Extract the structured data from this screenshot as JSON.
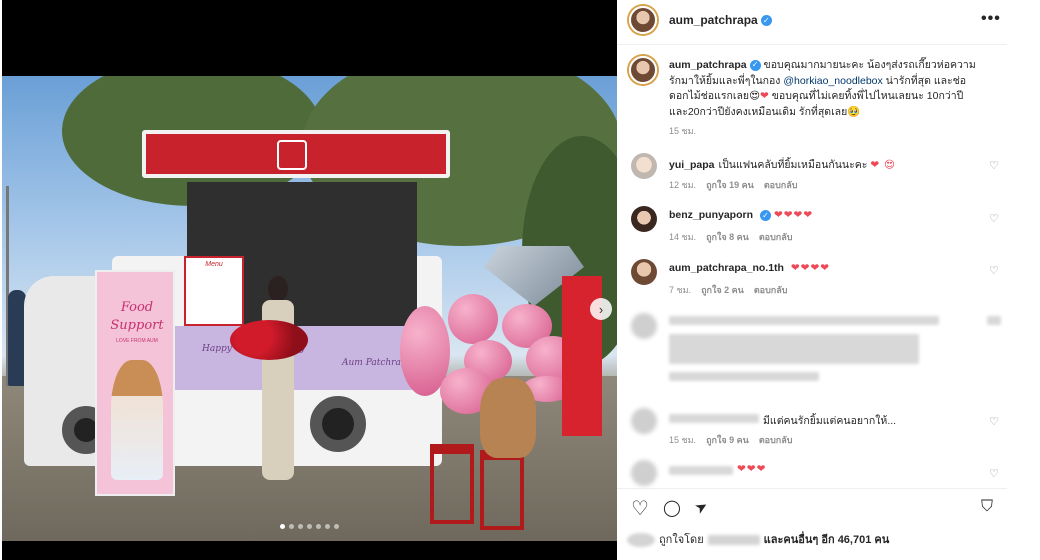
{
  "post": {
    "username": "aum_patchrapa",
    "more_label": "•••",
    "next_label": "›",
    "carousel": {
      "count": 7,
      "active_index": 0
    }
  },
  "photo_text": {
    "banner_title_1": "Food",
    "banner_title_2": "Support",
    "banner_sub": "LOVE FROM AUM",
    "counter_left": "Happy Valentine's Day",
    "counter_right": "Aum Patchrapa",
    "menu_board": "Menu"
  },
  "caption": {
    "username": "aum_patchrapa",
    "text_1": "ขอบคุณมากมายนะคะ น้องๆส่งรถเกี๊ยวห่อความรักมาให้ยิ้มและพี่ๆในกอง",
    "mention": "@horkiao_noodlebox",
    "text_2": "น่ารักที่สุด และช่อดอกไม้ช่อแรกเลย",
    "text_3": "ขอบคุณที่ไม่เคยทิ้งพี่ไปไหนเลยนะ 10กว่าปีและ20กว่าปียังคงเหมือนเดิม รักที่สุดเลย",
    "emoji_1": "😍",
    "emoji_heart": "❤",
    "emoji_2": "🥹",
    "time": "15 ชม."
  },
  "comments": [
    {
      "username": "yui_papa",
      "text": "เป็นแฟนคลับที่ยิ้มเหมือนกันนะคะ",
      "emoji": "❤ 😍",
      "time": "12 ชม.",
      "likes": "ถูกใจ 19 คน",
      "reply": "ตอบกลับ"
    },
    {
      "username": "benz_punyaporn",
      "text": "",
      "emoji": "❤❤❤❤",
      "time": "14 ชม.",
      "likes": "ถูกใจ 8 คน",
      "reply": "ตอบกลับ"
    },
    {
      "username": "aum_patchrapa_no.1th",
      "text": "",
      "emoji": "❤❤❤❤",
      "time": "7 ชม.",
      "likes": "ถูกใจ 2 คน",
      "reply": "ตอบกลับ"
    },
    {
      "username": "",
      "text": "มีแต่คนรักยิ้มแต่คนอยากให้...",
      "emoji": "",
      "time": "15 ชม.",
      "likes": "ถูกใจ 9 คน",
      "reply": "ตอบกลับ"
    },
    {
      "username": "",
      "text": "",
      "emoji": "❤❤❤",
      "time": "",
      "likes": "",
      "reply": ""
    }
  ],
  "likes": {
    "prefix": "ถูกใจโดย",
    "suffix": "และคนอื่นๆ อีก",
    "count": "46,701",
    "unit": "คน"
  },
  "icons": {
    "heart": "♡",
    "comment": "◯",
    "share": "➤",
    "save": "⛉"
  }
}
